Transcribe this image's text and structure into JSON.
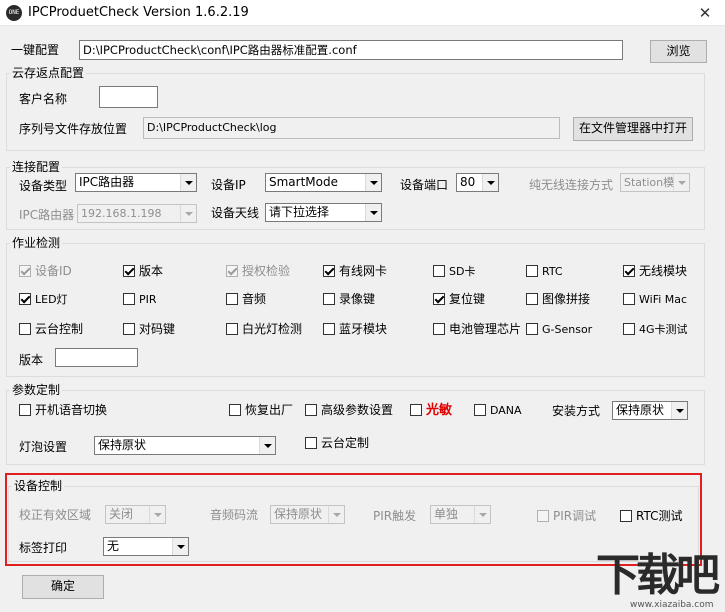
{
  "window": {
    "app_icon_text": "ONE",
    "title": "IPCProduetCheck Version 1.6.2.19",
    "close": "✕"
  },
  "onekey": {
    "label": "一键配置",
    "path": "D:\\IPCProductCheck\\conf\\IPC路由器标准配置.conf",
    "browse": "浏览"
  },
  "cloud": {
    "title": "云存返点配置",
    "customer_label": "客户名称",
    "customer_value": "",
    "serial_label": "序列号文件存放位置",
    "serial_path": "D:\\IPCProductCheck\\log",
    "open_button": "在文件管理器中打开"
  },
  "connection": {
    "title": "连接配置",
    "device_type_label": "设备类型",
    "device_type_value": "IPC路由器",
    "device_ip_label": "设备IP",
    "device_ip_value": "SmartMode",
    "device_port_label": "设备端口",
    "device_port_value": "80",
    "wireless_mode_label": "纯无线连接方式",
    "wireless_mode_value": "Station模",
    "ipc_router_label": "IPC路由器",
    "ipc_router_value": "192.168.1.198",
    "antenna_label": "设备天线",
    "antenna_value": "请下拉选择"
  },
  "job": {
    "title": "作业检测",
    "items": [
      {
        "label": "设备ID",
        "checked": true,
        "disabled": true
      },
      {
        "label": "版本",
        "checked": true,
        "disabled": false
      },
      {
        "label": "授权检验",
        "checked": true,
        "disabled": true
      },
      {
        "label": "有线网卡",
        "checked": true,
        "disabled": false
      },
      {
        "label": "SD卡",
        "checked": false,
        "disabled": false
      },
      {
        "label": "RTC",
        "checked": false,
        "disabled": false
      },
      {
        "label": "无线模块",
        "checked": true,
        "disabled": false
      },
      {
        "label": "LED灯",
        "checked": true,
        "disabled": false
      },
      {
        "label": "PIR",
        "checked": false,
        "disabled": false
      },
      {
        "label": "音频",
        "checked": false,
        "disabled": false
      },
      {
        "label": "录像键",
        "checked": false,
        "disabled": false
      },
      {
        "label": "复位键",
        "checked": true,
        "disabled": false
      },
      {
        "label": "图像拼接",
        "checked": false,
        "disabled": false
      },
      {
        "label": "WiFi Mac",
        "checked": false,
        "disabled": false
      },
      {
        "label": "云台控制",
        "checked": false,
        "disabled": false
      },
      {
        "label": "对码键",
        "checked": false,
        "disabled": false
      },
      {
        "label": "白光灯检测",
        "checked": false,
        "disabled": false
      },
      {
        "label": "蓝牙模块",
        "checked": false,
        "disabled": false
      },
      {
        "label": "电池管理芯片",
        "checked": false,
        "disabled": false
      },
      {
        "label": "G-Sensor",
        "checked": false,
        "disabled": false
      },
      {
        "label": "4G卡测试",
        "checked": false,
        "disabled": false
      }
    ],
    "version_label": "版本",
    "version_value": ""
  },
  "params": {
    "title": "参数定制",
    "voice_switch": {
      "label": "开机语音切换",
      "checked": false
    },
    "factory_reset": {
      "label": "恢复出厂",
      "checked": false
    },
    "advanced": {
      "label": "高级参数设置",
      "checked": false
    },
    "photosensitive": {
      "label": "光敏",
      "checked": false
    },
    "dana": {
      "label": "DANA",
      "checked": false
    },
    "install_label": "安装方式",
    "install_value": "保持原状",
    "bulb_label": "灯泡设置",
    "bulb_value": "保持原状",
    "ptz_custom": {
      "label": "云台定制",
      "checked": false
    }
  },
  "device_ctrl": {
    "title": "设备控制",
    "zone_label": "校正有效区域",
    "zone_value": "关闭",
    "stream_label": "音频码流",
    "stream_value": "保持原状",
    "pir_trigger_label": "PIR触发",
    "pir_trigger_value": "单独",
    "pir_debug": {
      "label": "PIR调试",
      "checked": false
    },
    "rtc_test": {
      "label": "RTC测试",
      "checked": false
    },
    "tag_print_label": "标签打印",
    "tag_print_value": "无"
  },
  "confirm": "确定",
  "watermark": {
    "text": "下载吧",
    "url": "www.xiazaiba.com"
  },
  "colors": {
    "highlight_red": "#e02020",
    "photosensitive_red": "#e00000"
  }
}
